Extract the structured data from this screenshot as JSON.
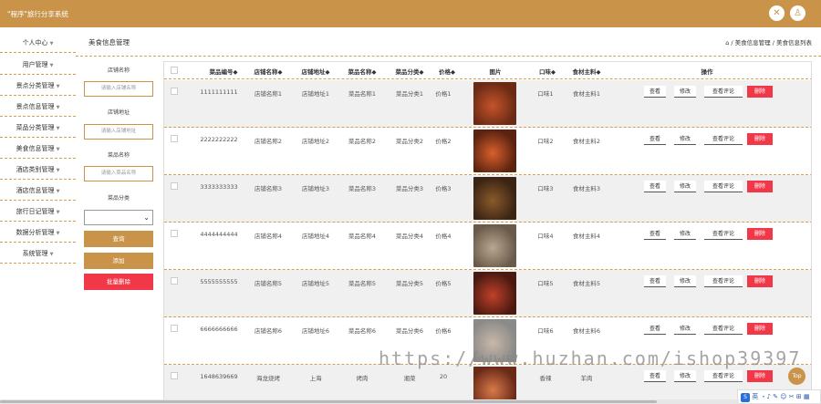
{
  "app": {
    "title": "\"程序\"旅行分享系统",
    "icons": [
      "tools-icon",
      "user-icon"
    ]
  },
  "sidebar": {
    "items": [
      {
        "label": "个人中心"
      },
      {
        "label": "用户管理"
      },
      {
        "label": "景点分类管理"
      },
      {
        "label": "景点信息管理"
      },
      {
        "label": "菜品分类管理"
      },
      {
        "label": "美食信息管理"
      },
      {
        "label": "酒店类别管理"
      },
      {
        "label": "酒店信息管理"
      },
      {
        "label": "旅行日记管理"
      },
      {
        "label": "数据分析管理"
      },
      {
        "label": "系统管理"
      }
    ]
  },
  "header": {
    "page_title": "美食信息管理",
    "breadcrumb": "/ 美食信息管理 / 美食信息列表"
  },
  "filters": {
    "shop_name_label": "店铺名称",
    "shop_name_placeholder": "请输入店铺名称",
    "shop_addr_label": "店铺地址",
    "shop_addr_placeholder": "请输入店铺地址",
    "dish_name_label": "菜品名称",
    "dish_name_placeholder": "请输入菜品名称",
    "dish_cat_label": "菜品分类",
    "dish_cat_value": "",
    "query_btn": "查询",
    "add_btn": "添加",
    "batch_delete_btn": "批量删除"
  },
  "table": {
    "headers": {
      "code": "菜品编号◆",
      "shop": "店铺名称◆",
      "addr": "店铺地址◆",
      "name": "菜品名称◆",
      "cat": "菜品分类◆",
      "price": "价格◆",
      "img": "图片",
      "taste": "口味◆",
      "ingredient": "食材主料◆",
      "ops": "操作"
    },
    "ops": {
      "view": "查看",
      "edit": "修改",
      "comments": "查看评论",
      "delete": "删除"
    },
    "rows": [
      {
        "code": "1111111111",
        "shop": "店铺名称1",
        "addr": "店铺地址1",
        "name": "菜品名称1",
        "cat": "菜品分类1",
        "price": "价格1",
        "taste": "口味1",
        "ingredient": "食材主料1",
        "img_colors": [
          "#6a2a14",
          "#c4542a"
        ]
      },
      {
        "code": "2222222222",
        "shop": "店铺名称2",
        "addr": "店铺地址2",
        "name": "菜品名称2",
        "cat": "菜品分类2",
        "price": "价格2",
        "taste": "口味2",
        "ingredient": "食材主料2",
        "img_colors": [
          "#5a2210",
          "#d8602c"
        ]
      },
      {
        "code": "3333333333",
        "shop": "店铺名称3",
        "addr": "店铺地址3",
        "name": "菜品名称3",
        "cat": "菜品分类3",
        "price": "价格3",
        "taste": "口味3",
        "ingredient": "食材主料3",
        "img_colors": [
          "#3a2414",
          "#8a5a2a"
        ]
      },
      {
        "code": "4444444444",
        "shop": "店铺名称4",
        "addr": "店铺地址4",
        "name": "菜品名称4",
        "cat": "菜品分类4",
        "price": "价格4",
        "taste": "口味4",
        "ingredient": "食材主料4",
        "img_colors": [
          "#6a5a4a",
          "#b8a890"
        ]
      },
      {
        "code": "5555555555",
        "shop": "店铺名称5",
        "addr": "店铺地址5",
        "name": "菜品名称5",
        "cat": "菜品分类5",
        "price": "价格5",
        "taste": "口味5",
        "ingredient": "食材主料5",
        "img_colors": [
          "#4a1a10",
          "#c0402a"
        ]
      },
      {
        "code": "6666666666",
        "shop": "店铺名称6",
        "addr": "店铺地址6",
        "name": "菜品名称6",
        "cat": "菜品分类6",
        "price": "价格6",
        "taste": "口味6",
        "ingredient": "食材主料6",
        "img_colors": [
          "#8a8a88",
          "#c8b8a8"
        ]
      },
      {
        "code": "1648639669",
        "shop": "海龙烧烤",
        "addr": "上海",
        "name": "烤肉",
        "cat": "湘菜",
        "price": "20",
        "taste": "香辣",
        "ingredient": "羊肉",
        "img_colors": [
          "#6a2a18",
          "#d87a4a"
        ]
      }
    ]
  },
  "overlay": {
    "watermark": "https://www.huzhan.com/ishop39397",
    "top_button": "Top",
    "ime_label": "英"
  },
  "colors": {
    "brand": "#c9944a",
    "danger": "#f03848"
  }
}
